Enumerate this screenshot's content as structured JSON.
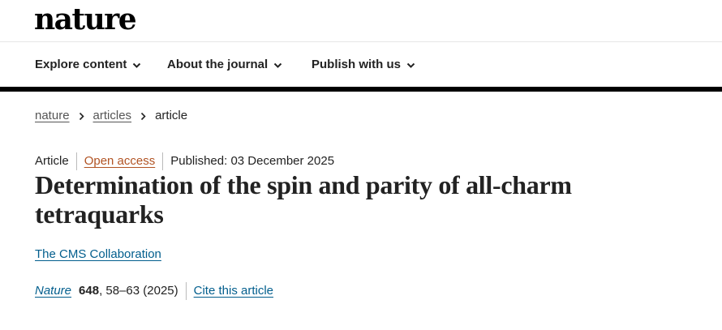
{
  "header": {
    "logo": "nature"
  },
  "nav": {
    "items": [
      {
        "label": "Explore content"
      },
      {
        "label": "About the journal"
      },
      {
        "label": "Publish with us"
      }
    ]
  },
  "breadcrumb": {
    "items": [
      "nature",
      "articles",
      "article"
    ]
  },
  "article": {
    "type": "Article",
    "access": "Open access",
    "published": "Published: 03 December 2025",
    "title": "Determination of the spin and parity of all-charm tetraquarks",
    "authors": "The CMS Collaboration",
    "citation": {
      "journal": "Nature",
      "volume": "648",
      "pages": ", 58–63 (2025)",
      "cite_label": "Cite this article"
    }
  },
  "colors": {
    "link": "#025e8d",
    "open_access": "#b15323",
    "text": "#222222",
    "rule": "#000000"
  }
}
